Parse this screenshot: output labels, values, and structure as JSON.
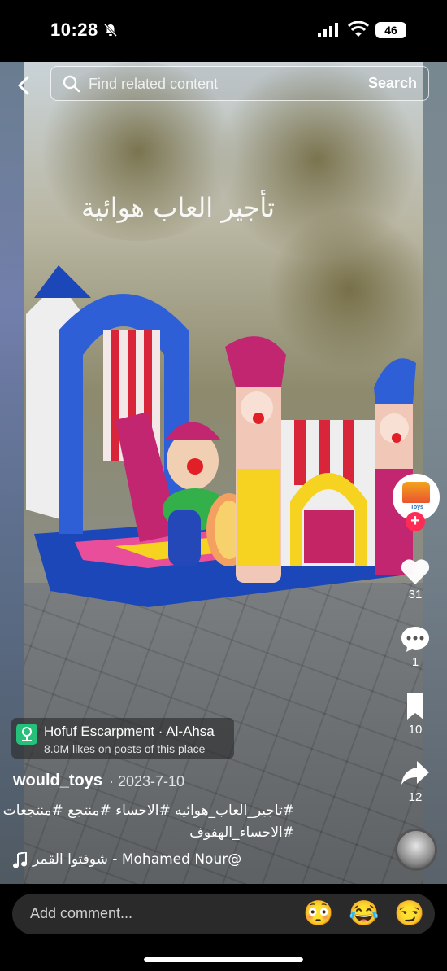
{
  "status_bar": {
    "time": "10:28",
    "battery": "46"
  },
  "search": {
    "placeholder": "Find related content",
    "button_label": "Search"
  },
  "video": {
    "overlay_text": "تأجير العاب هوائية"
  },
  "creator_avatar": {
    "caption": "Toys"
  },
  "actions": {
    "likes": "31",
    "comments": "1",
    "saves": "10",
    "shares": "12"
  },
  "location": {
    "name": "Hofuf Escarpment · Al-Ahsa",
    "likes_text": "8.0M likes on posts of this place"
  },
  "post": {
    "username": "would_toys",
    "date": "· 2023-7-10",
    "caption_line1": "#تاجير_العاب_هوائيه #الاحساء #منتجع #منتجعات",
    "caption_line2": "#الاحساء_الهفوف",
    "music": "شوفتوا القمر - Mohamed Nour@"
  },
  "comment_bar": {
    "placeholder": "Add comment...",
    "emojis": [
      "😳",
      "😂",
      "😏"
    ]
  },
  "colors": {
    "follow_red": "#fe2c55",
    "location_green": "#25c07a",
    "comment_field": "#2a2a2a"
  }
}
